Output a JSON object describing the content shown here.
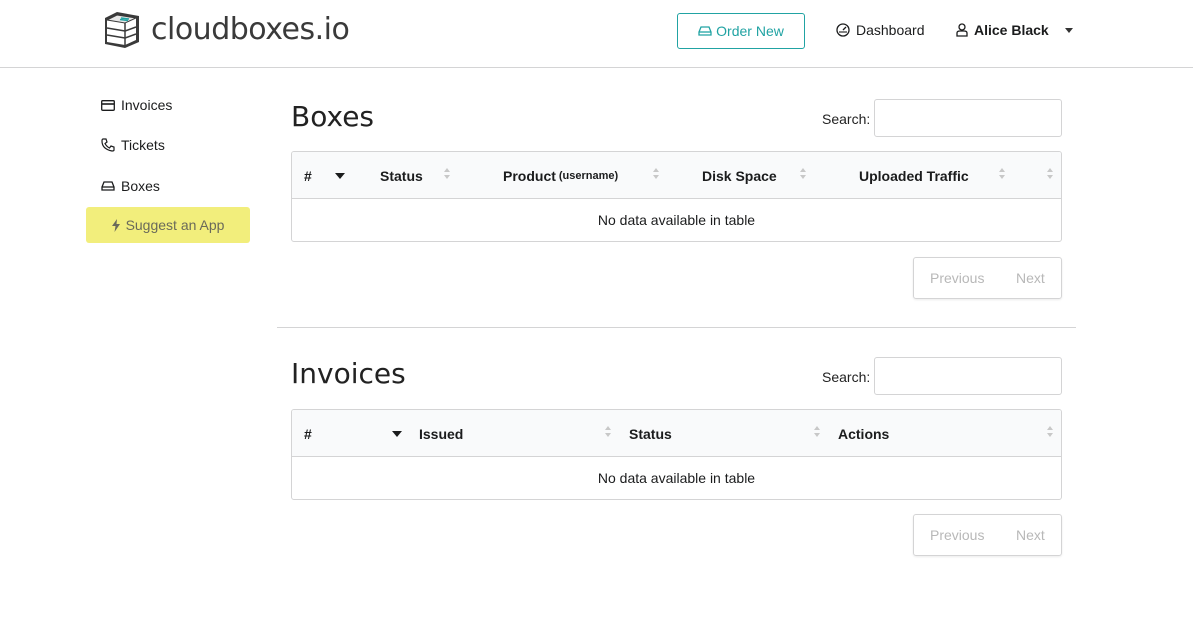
{
  "header": {
    "brand": "cloudboxes.io",
    "order_button": "Order New",
    "dashboard": "Dashboard",
    "user_name": "Alice Black"
  },
  "sidebar": {
    "items": [
      {
        "label": "Invoices",
        "icon": "credit-card-icon"
      },
      {
        "label": "Tickets",
        "icon": "phone-icon"
      },
      {
        "label": "Boxes",
        "icon": "hdd-icon"
      }
    ],
    "suggest": {
      "label": "Suggest an App",
      "icon": "lightning-icon"
    }
  },
  "boxes": {
    "title": "Boxes",
    "search_label": "Search:",
    "search_value": "",
    "columns": [
      "#",
      "Status",
      "Product",
      "Disk Space",
      "Uploaded Traffic"
    ],
    "product_suffix": "(username)",
    "empty": "No data available in table",
    "previous": "Previous",
    "next": "Next"
  },
  "invoices": {
    "title": "Invoices",
    "search_label": "Search:",
    "search_value": "",
    "columns": [
      "#",
      "Issued",
      "Status",
      "Actions"
    ],
    "empty": "No data available in table",
    "previous": "Previous",
    "next": "Next"
  },
  "colors": {
    "accent": "#21a3a3",
    "suggest_bg": "#f2ee7c",
    "border": "#d4d4d5"
  }
}
